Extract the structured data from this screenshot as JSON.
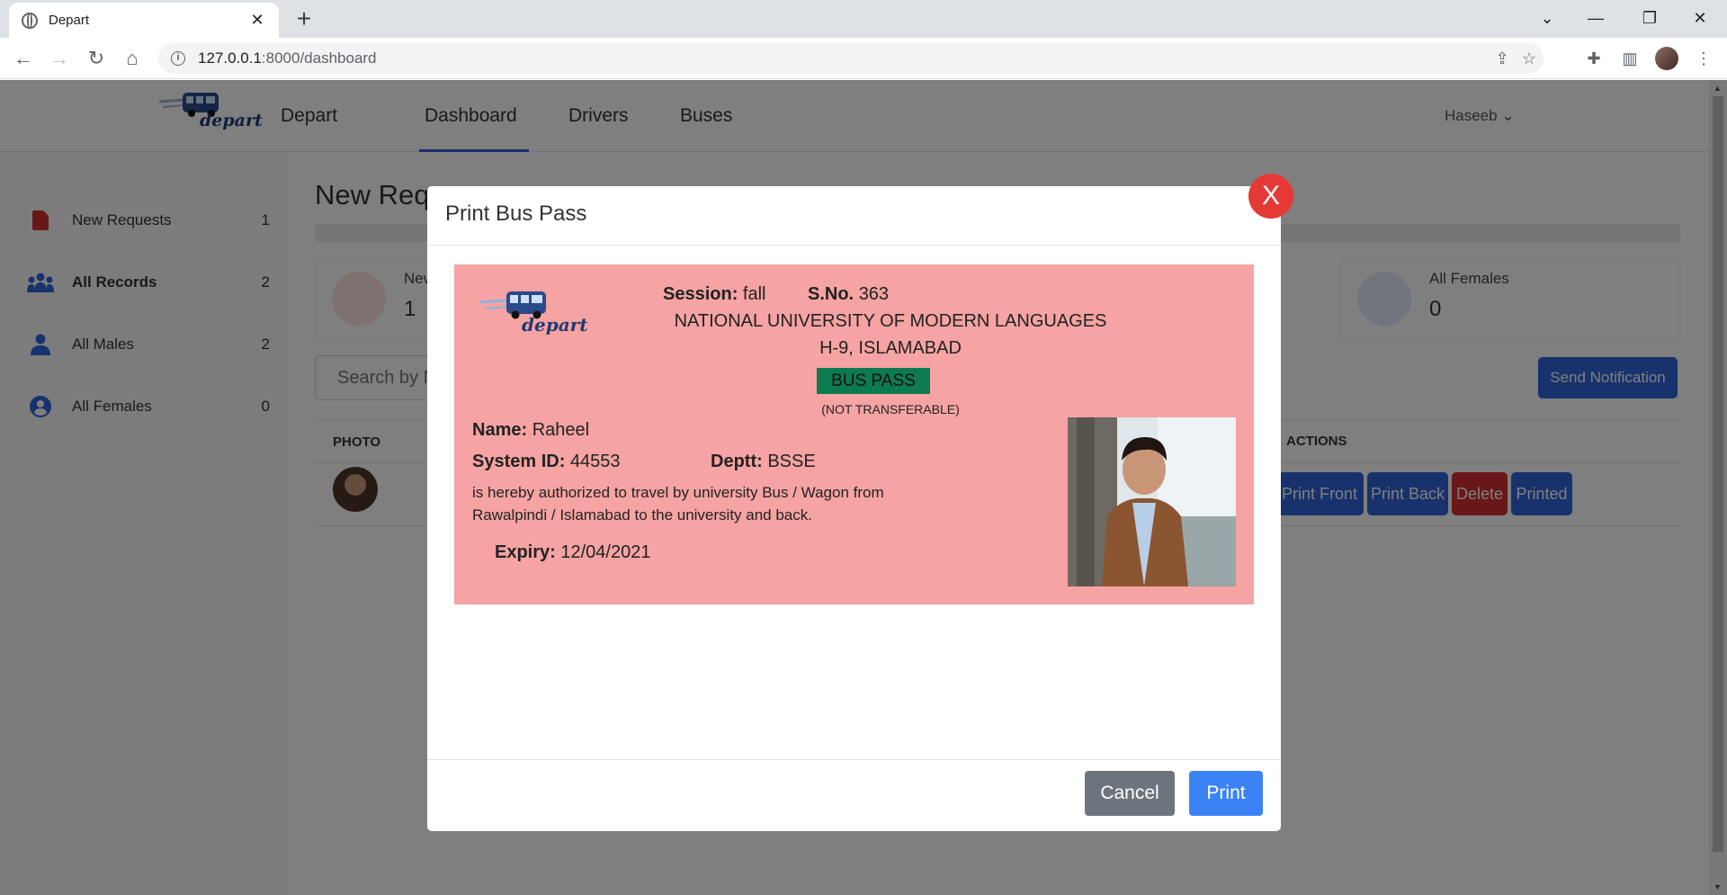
{
  "browser": {
    "tab_title": "Depart",
    "close_label": "✕",
    "newtab_label": "+",
    "url_host": "127.0.0.1",
    "url_rest": ":8000/dashboard"
  },
  "navbar": {
    "logo_text": "depart",
    "brand": "Depart",
    "links": [
      "Dashboard",
      "Drivers",
      "Buses"
    ],
    "user": "Haseeb"
  },
  "sidebar": {
    "items": [
      {
        "label": "New Requests",
        "count": "1"
      },
      {
        "label": "All Records",
        "count": "2"
      },
      {
        "label": "All Males",
        "count": "2"
      },
      {
        "label": "All Females",
        "count": "0"
      }
    ]
  },
  "content": {
    "title": "New Requ",
    "cards": [
      {
        "label": "New",
        "value": "1"
      },
      {
        "label": "All Females",
        "value": "0"
      }
    ],
    "search_placeholder": "Search by N",
    "notify_button": "Send Notification",
    "columns": [
      "PHOTO",
      "ACTIONS"
    ],
    "row_actions": [
      "Print Front",
      "Print Back",
      "Delete",
      "Printed"
    ]
  },
  "modal": {
    "title": "Print Bus Pass",
    "close_label": "X",
    "cancel": "Cancel",
    "print": "Print"
  },
  "pass": {
    "logo_text": "depart",
    "session_label": "Session:",
    "session_value": "fall",
    "sno_label": "S.No.",
    "sno_value": "363",
    "university": "NATIONAL UNIVERSITY OF MODERN LANGUAGES",
    "address": "H-9, ISLAMABAD",
    "badge": "BUS PASS",
    "note": "(NOT TRANSFERABLE)",
    "name_label": "Name:",
    "name_value": "Raheel",
    "sysid_label": "System ID:",
    "sysid_value": "44553",
    "dept_label": "Deptt:",
    "dept_value": "BSSE",
    "authorization": "is hereby authorized to travel by university Bus / Wagon from Rawalpindi / Islamabad to the university and back.",
    "expiry_label": "Expiry:",
    "expiry_value": "12/04/2021"
  }
}
